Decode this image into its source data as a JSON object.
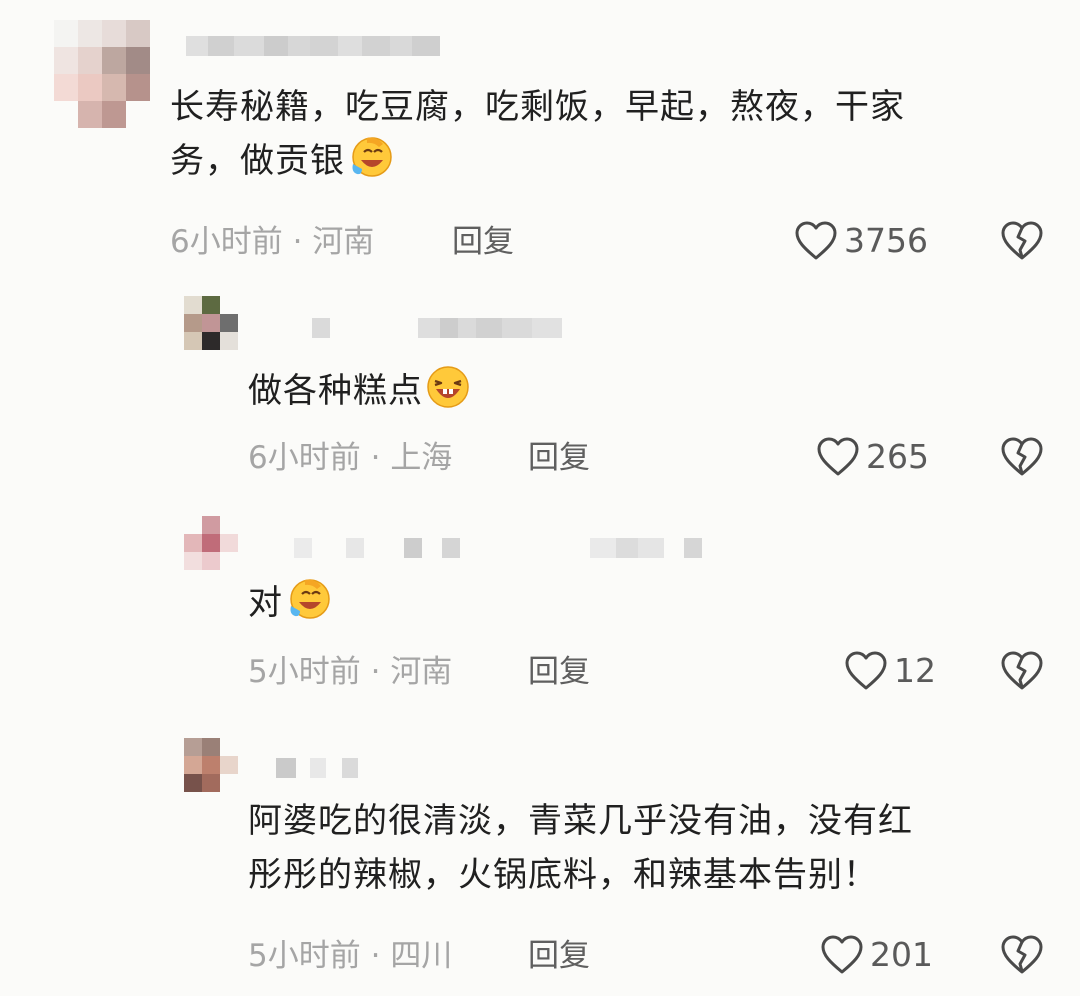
{
  "comments": [
    {
      "text_lines": [
        "长寿秘籍，吃豆腐，吃剩饭，早起，熬夜，干家",
        "务，做贡银"
      ],
      "emoji": "facepalm-laugh-emoji",
      "time": "6小时前",
      "separator": "·",
      "location": "河南",
      "reply_label": "回复",
      "like_count": "3756"
    },
    {
      "text_lines": [
        "做各种糕点"
      ],
      "emoji": "grinning-laugh-emoji",
      "time": "6小时前",
      "separator": "·",
      "location": "上海",
      "reply_label": "回复",
      "like_count": "265"
    },
    {
      "text_lines": [
        "对"
      ],
      "emoji": "facepalm-laugh-emoji",
      "time": "5小时前",
      "separator": "·",
      "location": "河南",
      "reply_label": "回复",
      "like_count": "12"
    },
    {
      "text_lines": [
        "阿婆吃的很清淡，青菜几乎没有油，没有红",
        "彤彤的辣椒，火锅底料，和辣基本告别！"
      ],
      "emoji": "",
      "time": "5小时前",
      "separator": "·",
      "location": "四川",
      "reply_label": "回复",
      "like_count": "201"
    }
  ],
  "icons": {
    "like": "heart-outline-icon",
    "dislike": "broken-heart-icon"
  },
  "colors": {
    "background": "#fbfbf9",
    "text": "#202020",
    "meta": "#a5a5a5",
    "reply": "#5f5f5f",
    "count": "#5a5a5a"
  }
}
